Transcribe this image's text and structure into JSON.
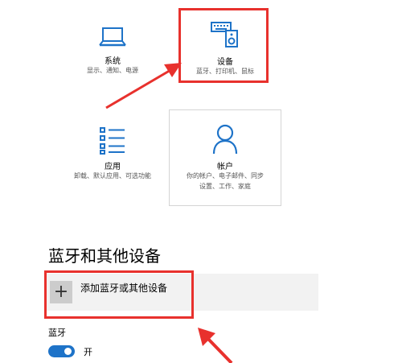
{
  "tiles": {
    "system": {
      "title": "系统",
      "desc": "显示、通知、电源"
    },
    "devices": {
      "title": "设备",
      "desc": "蓝牙、打印机、鼠标"
    },
    "apps": {
      "title": "应用",
      "desc": "卸载、默认应用、可选功能"
    },
    "accounts": {
      "title": "帐户",
      "desc_line1": "你的帐户、电子邮件、同步",
      "desc_line2": "设置、工作、家庭"
    }
  },
  "section": {
    "heading": "蓝牙和其他设备",
    "add_button_symbol": "+",
    "add_button_label": "添加蓝牙或其他设备",
    "bluetooth_label": "蓝牙",
    "bluetooth_toggle_state": "开",
    "bluetooth_on": true
  },
  "icons": [
    "laptop-icon",
    "devices-icon",
    "apps-list-icon",
    "person-icon",
    "plus-icon"
  ],
  "colors": {
    "accent": "#1e73c8",
    "annotation_red": "#e8312d",
    "tile_border": "#d4d4d4"
  }
}
